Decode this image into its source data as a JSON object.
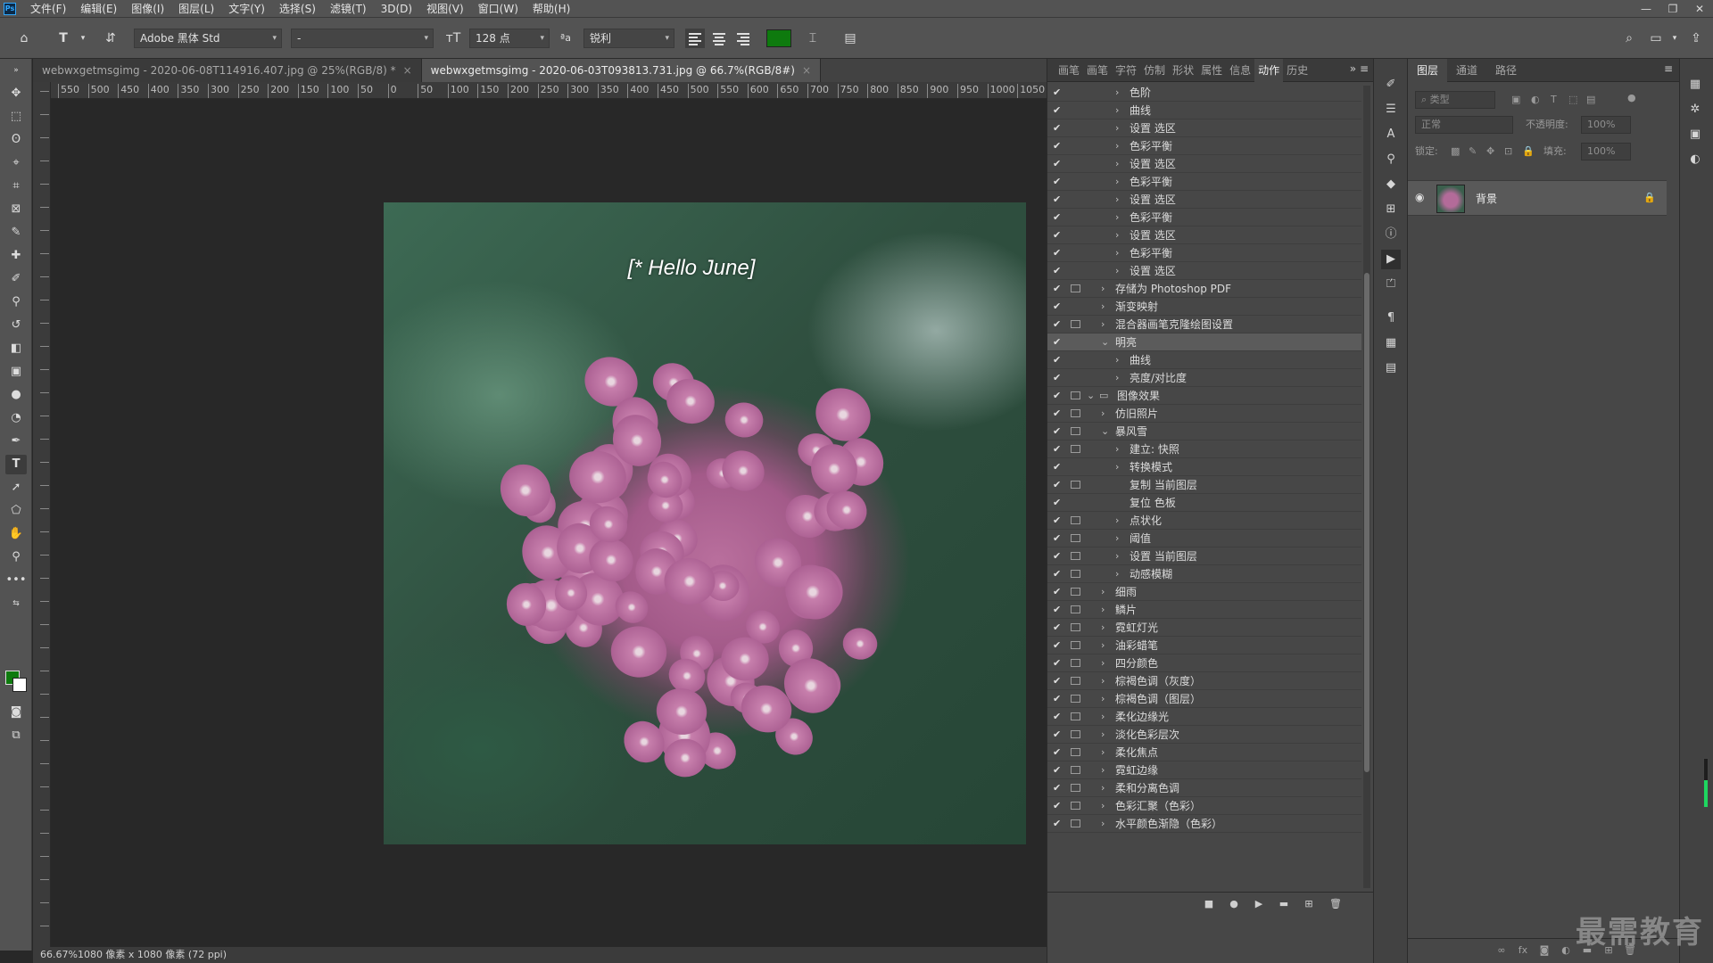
{
  "app": {
    "logo": "Ps",
    "menu": [
      "文件(F)",
      "编辑(E)",
      "图像(I)",
      "图层(L)",
      "文字(Y)",
      "选择(S)",
      "滤镜(T)",
      "3D(D)",
      "视图(V)",
      "窗口(W)",
      "帮助(H)"
    ],
    "window_controls": [
      "—",
      "❐",
      "✕"
    ]
  },
  "options": {
    "font_family": "Adobe 黑体 Std",
    "font_style": "-",
    "font_size": "128 点",
    "aa_label": "ªa",
    "anti_alias": "锐利",
    "text_color": "#0e7a0e"
  },
  "tabs": [
    {
      "label": "webwxgetmsgimg - 2020-06-08T114916.407.jpg @ 25%(RGB/8) *",
      "close": "×"
    },
    {
      "label": "webwxgetmsgimg - 2020-06-03T093813.731.jpg @ 66.7%(RGB/8#)",
      "close": "×"
    }
  ],
  "ruler": {
    "h_labels": [
      "550",
      "500",
      "450",
      "400",
      "350",
      "300",
      "250",
      "200",
      "150",
      "100",
      "50",
      "0",
      "50",
      "100",
      "150",
      "200",
      "250",
      "300",
      "350",
      "400",
      "450",
      "500",
      "550",
      "600",
      "650",
      "700",
      "750",
      "800",
      "850",
      "900",
      "950",
      "1000",
      "1050",
      "1"
    ]
  },
  "canvas": {
    "caption": "[* Hello June]"
  },
  "status": {
    "text": "66.67%1080 像素 x 1080 像素 (72 ppi)"
  },
  "actions_panel": {
    "tabs": [
      "画笔",
      "画笔",
      "字符",
      "仿制",
      "形状",
      "属性",
      "信息",
      "动作",
      "历史"
    ],
    "active_tab": "动作",
    "rows": [
      {
        "label": "色阶",
        "level": 2,
        "dialog": false,
        "open": false
      },
      {
        "label": "曲线",
        "level": 2,
        "dialog": false,
        "open": false
      },
      {
        "label": "设置 选区",
        "level": 2,
        "dialog": false,
        "open": false
      },
      {
        "label": "色彩平衡",
        "level": 2,
        "dialog": false,
        "open": false
      },
      {
        "label": "设置 选区",
        "level": 2,
        "dialog": false,
        "open": false
      },
      {
        "label": "色彩平衡",
        "level": 2,
        "dialog": false,
        "open": false
      },
      {
        "label": "设置 选区",
        "level": 2,
        "dialog": false,
        "open": false
      },
      {
        "label": "色彩平衡",
        "level": 2,
        "dialog": false,
        "open": false
      },
      {
        "label": "设置 选区",
        "level": 2,
        "dialog": false,
        "open": false
      },
      {
        "label": "色彩平衡",
        "level": 2,
        "dialog": false,
        "open": false
      },
      {
        "label": "设置 选区",
        "level": 2,
        "dialog": false,
        "open": false
      },
      {
        "label": "存储为 Photoshop PDF",
        "level": 1,
        "dialog": true,
        "open": false
      },
      {
        "label": "渐变映射",
        "level": 1,
        "dialog": false,
        "open": false
      },
      {
        "label": "混合器画笔克隆绘图设置",
        "level": 1,
        "dialog": true,
        "open": false
      },
      {
        "label": "明亮",
        "level": 1,
        "dialog": false,
        "open": true,
        "selected": true
      },
      {
        "label": "曲线",
        "level": 2,
        "dialog": false,
        "open": false
      },
      {
        "label": "亮度/对比度",
        "level": 2,
        "dialog": false,
        "open": false
      },
      {
        "label": "图像效果",
        "level": 0,
        "dialog": true,
        "open": true,
        "folder": true
      },
      {
        "label": "仿旧照片",
        "level": 1,
        "dialog": true,
        "open": false
      },
      {
        "label": "暴风雪",
        "level": 1,
        "dialog": true,
        "open": true
      },
      {
        "label": "建立: 快照",
        "level": 2,
        "dialog": true,
        "open": false
      },
      {
        "label": "转换模式",
        "level": 2,
        "dialog": false,
        "open": false
      },
      {
        "label": "复制 当前图层",
        "level": 2,
        "dialog": true,
        "open": false,
        "nochev": true
      },
      {
        "label": "复位 色板",
        "level": 2,
        "dialog": false,
        "open": false,
        "nochev": true
      },
      {
        "label": "点状化",
        "level": 2,
        "dialog": true,
        "open": false
      },
      {
        "label": "阈值",
        "level": 2,
        "dialog": true,
        "open": false
      },
      {
        "label": "设置 当前图层",
        "level": 2,
        "dialog": true,
        "open": false
      },
      {
        "label": "动感模糊",
        "level": 2,
        "dialog": true,
        "open": false
      },
      {
        "label": "细雨",
        "level": 1,
        "dialog": true,
        "open": false
      },
      {
        "label": "鳞片",
        "level": 1,
        "dialog": true,
        "open": false
      },
      {
        "label": "霓虹灯光",
        "level": 1,
        "dialog": true,
        "open": false
      },
      {
        "label": "油彩蜡笔",
        "level": 1,
        "dialog": true,
        "open": false
      },
      {
        "label": "四分颜色",
        "level": 1,
        "dialog": true,
        "open": false
      },
      {
        "label": "棕褐色调（灰度）",
        "level": 1,
        "dialog": true,
        "open": false
      },
      {
        "label": "棕褐色调（图层）",
        "level": 1,
        "dialog": true,
        "open": false
      },
      {
        "label": "柔化边缘光",
        "level": 1,
        "dialog": true,
        "open": false
      },
      {
        "label": "淡化色彩层次",
        "level": 1,
        "dialog": true,
        "open": false
      },
      {
        "label": "柔化焦点",
        "level": 1,
        "dialog": true,
        "open": false
      },
      {
        "label": "霓虹边缘",
        "level": 1,
        "dialog": true,
        "open": false
      },
      {
        "label": "柔和分离色调",
        "level": 1,
        "dialog": true,
        "open": false
      },
      {
        "label": "色彩汇聚（色彩）",
        "level": 1,
        "dialog": true,
        "open": false
      },
      {
        "label": "水平颜色渐隐（色彩）",
        "level": 1,
        "dialog": true,
        "open": false
      }
    ],
    "footer": [
      "■",
      "●",
      "▶",
      "▬",
      "⊞",
      "🗑"
    ]
  },
  "layers_panel": {
    "tabs": [
      "图层",
      "通道",
      "路径"
    ],
    "filter_placeholder": "类型",
    "blend_mode": "正常",
    "opacity_label": "不透明度:",
    "opacity_value": "100%",
    "lock_label": "锁定:",
    "fill_label": "填充:",
    "fill_value": "100%",
    "layer_name": "背景"
  },
  "watermark": "最需教育"
}
